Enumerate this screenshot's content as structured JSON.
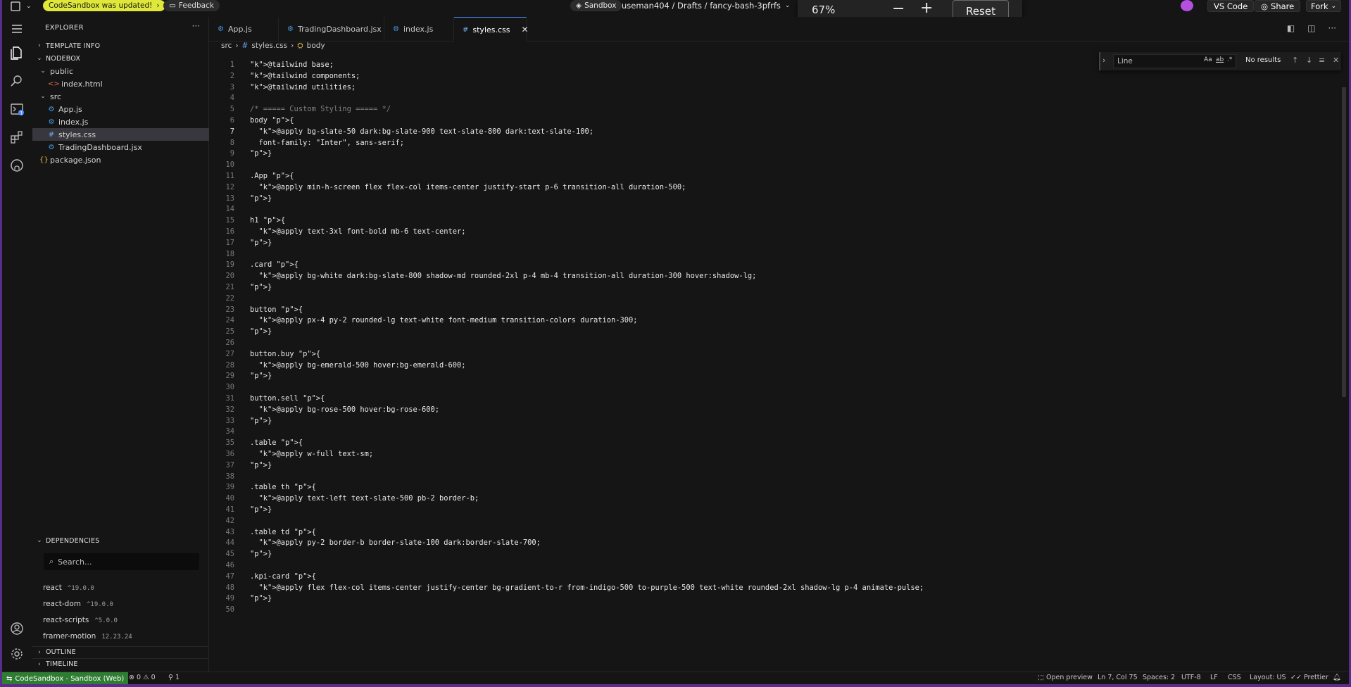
{
  "topbar": {
    "update_notice": "CodeSandbox was updated!",
    "feedback": "Feedback",
    "sandbox_label": "Sandbox",
    "path": "useman404 / Drafts / fancy-bash-3pfrfs",
    "vscode": "VS Code",
    "share": "Share",
    "fork": "Fork"
  },
  "zoom": {
    "value": "67%",
    "reset": "Reset"
  },
  "sidebar": {
    "title": "EXPLORER",
    "template_info": "TEMPLATE INFO",
    "nodebox": "NODEBOX",
    "tree": [
      {
        "label": "public",
        "kind": "folder"
      },
      {
        "label": "index.html",
        "kind": "html"
      },
      {
        "label": "src",
        "kind": "folder"
      },
      {
        "label": "App.js",
        "kind": "js"
      },
      {
        "label": "index.js",
        "kind": "js"
      },
      {
        "label": "styles.css",
        "kind": "css"
      },
      {
        "label": "TradingDashboard.jsx",
        "kind": "jsx"
      },
      {
        "label": "package.json",
        "kind": "json"
      }
    ],
    "dependencies_title": "DEPENDENCIES",
    "dep_search_placeholder": "Search...",
    "dependencies": [
      {
        "name": "react",
        "version": "^19.0.0"
      },
      {
        "name": "react-dom",
        "version": "^19.0.0"
      },
      {
        "name": "react-scripts",
        "version": "^5.0.0"
      },
      {
        "name": "framer-motion",
        "version": "12.23.24"
      }
    ],
    "outline": "OUTLINE",
    "timeline": "TIMELINE"
  },
  "tabs": [
    {
      "label": "App.js"
    },
    {
      "label": "TradingDashboard.jsx"
    },
    {
      "label": "index.js"
    },
    {
      "label": "styles.css"
    }
  ],
  "breadcrumb": {
    "root": "src",
    "file": "styles.css",
    "symbol": "body"
  },
  "find": {
    "placeholder": "Line",
    "aa": "Aa",
    "word": "ab",
    "status": "No results"
  },
  "code": [
    "@tailwind base;",
    "@tailwind components;",
    "@tailwind utilities;",
    "",
    "/* ===== Custom Styling ===== */",
    "body {",
    "  @apply bg-slate-50 dark:bg-slate-900 text-slate-800 dark:text-slate-100;",
    "  font-family: \"Inter\", sans-serif;",
    "}",
    "",
    ".App {",
    "  @apply min-h-screen flex flex-col items-center justify-start p-6 transition-all duration-500;",
    "}",
    "",
    "h1 {",
    "  @apply text-3xl font-bold mb-6 text-center;",
    "}",
    "",
    ".card {",
    "  @apply bg-white dark:bg-slate-800 shadow-md rounded-2xl p-4 mb-4 transition-all duration-300 hover:shadow-lg;",
    "}",
    "",
    "button {",
    "  @apply px-4 py-2 rounded-lg text-white font-medium transition-colors duration-300;",
    "}",
    "",
    "button.buy {",
    "  @apply bg-emerald-500 hover:bg-emerald-600;",
    "}",
    "",
    "button.sell {",
    "  @apply bg-rose-500 hover:bg-rose-600;",
    "}",
    "",
    ".table {",
    "  @apply w-full text-sm;",
    "}",
    "",
    ".table th {",
    "  @apply text-left text-slate-500 pb-2 border-b;",
    "}",
    "",
    ".table td {",
    "  @apply py-2 border-b border-slate-100 dark:border-slate-700;",
    "}",
    "",
    ".kpi-card {",
    "  @apply flex flex-col items-center justify-center bg-gradient-to-r from-indigo-500 to-purple-500 text-white rounded-2xl shadow-lg p-4 animate-pulse;",
    "}",
    ""
  ],
  "statusbar": {
    "remote": "CodeSandbox - Sandbox (Web)",
    "problems": "0",
    "warnings": "0",
    "ports": "1",
    "open_preview": "Open preview",
    "position": "Ln 7, Col 75",
    "spaces": "Spaces: 2",
    "encoding": "UTF-8",
    "eol": "LF",
    "language": "CSS",
    "layout": "Layout: US",
    "prettier": "Prettier"
  },
  "colors": {
    "accent": "#4c8dff",
    "notice": "#dfe83a",
    "remote": "#2e7d32",
    "frame": "#5a2d8c"
  }
}
